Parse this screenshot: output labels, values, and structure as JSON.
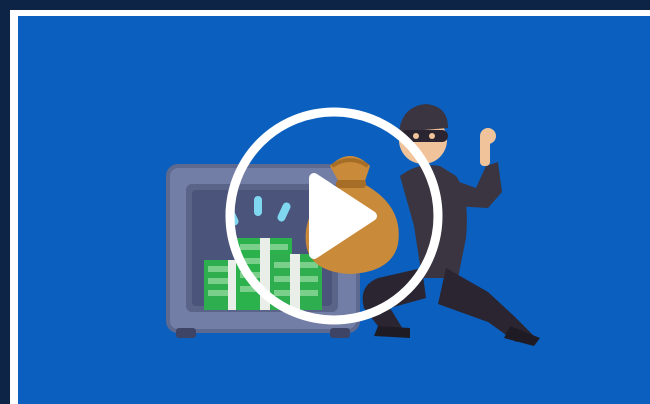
{
  "video": {
    "thumbnail_description_visible_text": "",
    "play_button_icon": "play-icon",
    "accent_colors": {
      "background": "#0b5fbf",
      "frame": "#0d2447",
      "border": "#ffffff",
      "play_ring": "#ffffff",
      "safe": "#6f7ba3",
      "money": "#2bb24c",
      "bag": "#c98a3a",
      "thief": "#3a3540"
    }
  }
}
